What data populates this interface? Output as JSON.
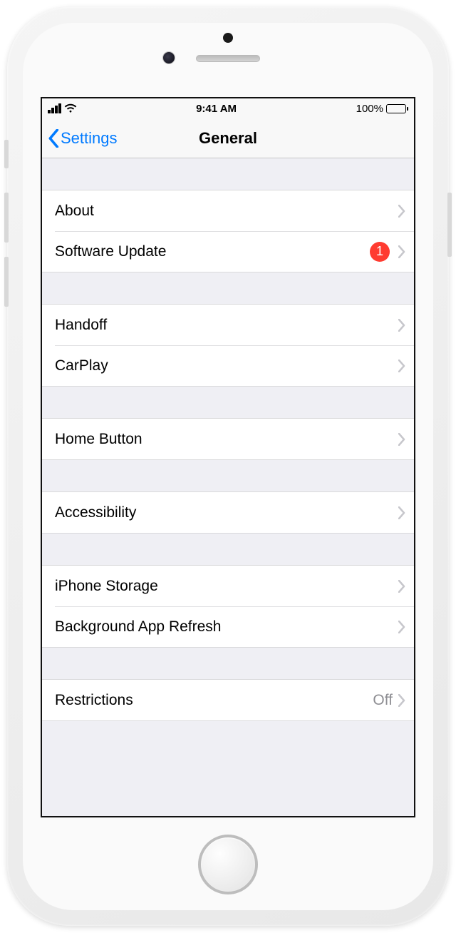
{
  "status": {
    "time": "9:41 AM",
    "battery_pct": "100%"
  },
  "nav": {
    "back_label": "Settings",
    "title": "General"
  },
  "rows": {
    "about": "About",
    "software_update": "Software Update",
    "software_update_badge": "1",
    "handoff": "Handoff",
    "carplay": "CarPlay",
    "home_button": "Home Button",
    "accessibility": "Accessibility",
    "iphone_storage": "iPhone Storage",
    "background_app_refresh": "Background App Refresh",
    "restrictions": "Restrictions",
    "restrictions_value": "Off"
  }
}
